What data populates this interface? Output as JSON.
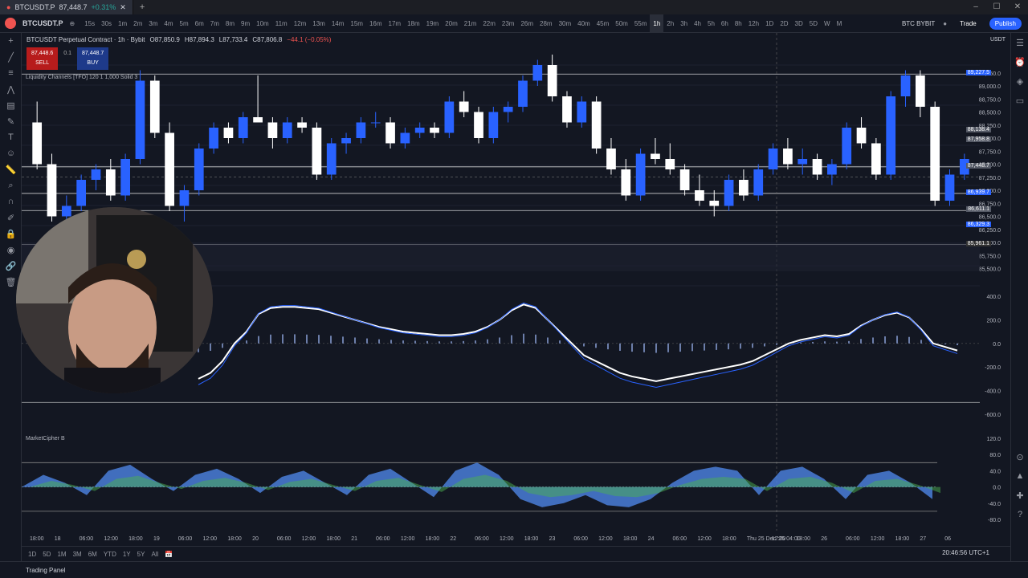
{
  "browser": {
    "tab_label": "BTCUSDT.P",
    "tab_price": "87,448.7",
    "tab_change": "+0.31%"
  },
  "window_controls": [
    "–",
    "☐",
    "✕"
  ],
  "toolbar": {
    "symbol": "BTCUSDT.P",
    "timeframes": [
      "15s",
      "30s",
      "1m",
      "2m",
      "3m",
      "4m",
      "5m",
      "6m",
      "7m",
      "8m",
      "9m",
      "10m",
      "11m",
      "12m",
      "13m",
      "14m",
      "15m",
      "16m",
      "17m",
      "18m",
      "19m",
      "20m",
      "21m",
      "22m",
      "23m",
      "26m",
      "28m",
      "30m",
      "40m",
      "45m",
      "50m",
      "55m",
      "1h",
      "2h",
      "3h",
      "4h",
      "5h",
      "6h",
      "8h",
      "12h",
      "1D",
      "2D",
      "3D",
      "5D",
      "W",
      "M"
    ],
    "active_timeframe": "1h",
    "broker": "BTC BYBIT",
    "trade_label": "Trade",
    "publish_label": "Publish"
  },
  "legend": {
    "title": "BTCUSDT Perpetual Contract · 1h · Bybit",
    "open": "O87,850.9",
    "high": "H87,894.3",
    "low": "L87,733.4",
    "close": "C87,806.8",
    "change": "−44.1 (−0.05%)",
    "sell_price": "87,448.6",
    "sell_label": "SELL",
    "spread": "0.1",
    "buy_price": "87,448.7",
    "buy_label": "BUY"
  },
  "indicators": {
    "liquidity": "Liquidity Channels [TFO] 120 1 1,000 Solid 3",
    "marketcipher": "MarketCipher B"
  },
  "price_axis": {
    "currency": "USDT",
    "labels": [
      "89,250.0",
      "89,000.0",
      "88,750.0",
      "88,500.0",
      "88,250.0",
      "88,000.0",
      "87,750.0",
      "87,500.0",
      "87,250.0",
      "87,000.0",
      "86,750.0",
      "86,500.0",
      "86,250.0",
      "86,000.0",
      "85,750.0",
      "85,500.0"
    ],
    "tags": [
      {
        "text": "89,227.5",
        "color": "#2962ff"
      },
      {
        "text": "88,138.4",
        "color": "#555a66"
      },
      {
        "text": "87,958.8",
        "color": "#555a66"
      },
      {
        "text": "87,448.7",
        "color": "#555a66"
      },
      {
        "text": "86,939.7",
        "color": "#2962ff"
      },
      {
        "text": "86,611.1",
        "color": "#555a66"
      },
      {
        "text": "86,329.3",
        "color": "#2962ff"
      },
      {
        "text": "85,961.1",
        "color": "#333"
      }
    ]
  },
  "macd_axis": [
    "400.0",
    "200.0",
    "0.0",
    "-200.0",
    "-400.0",
    "-600.0"
  ],
  "mc_axis": [
    "120.0",
    "80.0",
    "40.0",
    "0.0",
    "-40.0",
    "-80.0"
  ],
  "time_axis": [
    "18:00",
    "18",
    "06:00",
    "12:00",
    "18:00",
    "19",
    "06:00",
    "12:00",
    "18:00",
    "20",
    "06:00",
    "12:00",
    "18:00",
    "21",
    "06:00",
    "12:00",
    "18:00",
    "22",
    "06:00",
    "12:00",
    "18:00",
    "23",
    "06:00",
    "12:00",
    "18:00",
    "24",
    "06:00",
    "12:00",
    "18:00",
    "Thu 25 Dec '25  04:00",
    "12:00",
    "18:00",
    "26",
    "06:00",
    "12:00",
    "18:00",
    "27",
    "06"
  ],
  "bottombar": {
    "ranges": [
      "1D",
      "5D",
      "1M",
      "3M",
      "6M",
      "YTD",
      "1Y",
      "5Y",
      "All"
    ],
    "clock": "20:46:56 UTC+1"
  },
  "statusbar": {
    "panel_label": "Trading Panel"
  },
  "candles": [
    [
      88300,
      88700,
      87400,
      87500
    ],
    [
      87500,
      87700,
      86400,
      86500
    ],
    [
      86500,
      86900,
      86300,
      86700
    ],
    [
      86700,
      87300,
      86600,
      87200
    ],
    [
      87200,
      87500,
      87000,
      87400
    ],
    [
      87400,
      87600,
      86800,
      86900
    ],
    [
      86900,
      87700,
      86800,
      87600
    ],
    [
      87600,
      89300,
      87500,
      89100
    ],
    [
      89100,
      89200,
      88000,
      88100
    ],
    [
      88100,
      88300,
      86600,
      86700
    ],
    [
      86700,
      87100,
      86400,
      87000
    ],
    [
      87000,
      87900,
      86900,
      87800
    ],
    [
      87800,
      88300,
      87700,
      88200
    ],
    [
      88200,
      88300,
      87900,
      88000
    ],
    [
      88000,
      88500,
      87900,
      88400
    ],
    [
      88400,
      89200,
      88300,
      88300
    ],
    [
      88300,
      88400,
      87800,
      88000
    ],
    [
      88000,
      88400,
      87900,
      88300
    ],
    [
      88300,
      88400,
      88100,
      88200
    ],
    [
      88200,
      88300,
      87200,
      87300
    ],
    [
      87300,
      88000,
      87200,
      87900
    ],
    [
      87900,
      88100,
      87700,
      88000
    ],
    [
      88000,
      88400,
      87900,
      88300
    ],
    [
      88300,
      88500,
      88200,
      88300
    ],
    [
      88300,
      88400,
      87800,
      87900
    ],
    [
      87900,
      88200,
      87800,
      88100
    ],
    [
      88100,
      88300,
      88000,
      88200
    ],
    [
      88200,
      88300,
      88000,
      88100
    ],
    [
      88100,
      88800,
      88000,
      88700
    ],
    [
      88700,
      88900,
      88400,
      88500
    ],
    [
      88500,
      88600,
      87900,
      88000
    ],
    [
      88000,
      88600,
      87900,
      88500
    ],
    [
      88500,
      88700,
      88300,
      88600
    ],
    [
      88600,
      89200,
      88500,
      89100
    ],
    [
      89100,
      89500,
      89000,
      89400
    ],
    [
      89400,
      89600,
      88700,
      88800
    ],
    [
      88800,
      88900,
      88200,
      88300
    ],
    [
      88300,
      88800,
      88200,
      88700
    ],
    [
      88700,
      88800,
      87700,
      87800
    ],
    [
      87800,
      88000,
      87300,
      87400
    ],
    [
      87400,
      87600,
      86800,
      86900
    ],
    [
      86900,
      87800,
      86800,
      87700
    ],
    [
      87700,
      88000,
      87500,
      87600
    ],
    [
      87600,
      87900,
      87300,
      87400
    ],
    [
      87400,
      87500,
      86900,
      87000
    ],
    [
      87000,
      87300,
      86700,
      86800
    ],
    [
      86800,
      87000,
      86500,
      86700
    ],
    [
      86700,
      87300,
      86600,
      87200
    ],
    [
      87200,
      87400,
      86800,
      86900
    ],
    [
      86900,
      87500,
      86800,
      87400
    ],
    [
      87400,
      87900,
      87300,
      87800
    ],
    [
      87800,
      88000,
      87400,
      87500
    ],
    [
      87500,
      87800,
      87300,
      87600
    ],
    [
      87600,
      87700,
      87200,
      87300
    ],
    [
      87300,
      87600,
      87100,
      87500
    ],
    [
      87500,
      88300,
      87400,
      88200
    ],
    [
      88200,
      88400,
      87800,
      87900
    ],
    [
      87900,
      88000,
      87200,
      87300
    ],
    [
      87300,
      88900,
      87200,
      88800
    ],
    [
      88800,
      89300,
      88600,
      89200
    ],
    [
      89200,
      89300,
      88400,
      88600
    ],
    [
      88600,
      88700,
      86700,
      86800
    ],
    [
      86800,
      87400,
      86700,
      87300
    ],
    [
      87300,
      87700,
      87200,
      87600
    ]
  ],
  "colors": {
    "up": "#2962ff",
    "down": "#ffffff",
    "bg": "#131722",
    "grid": "#1c2030"
  }
}
